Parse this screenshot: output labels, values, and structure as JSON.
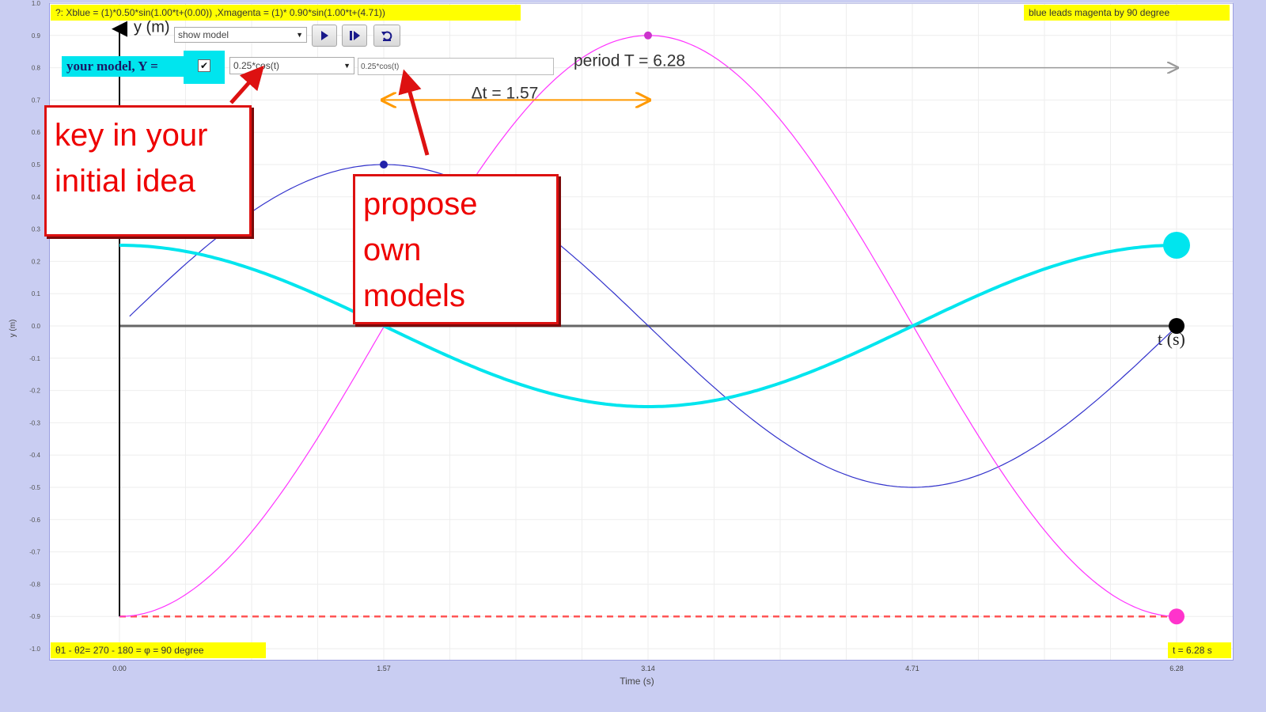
{
  "chart_data": {
    "type": "line",
    "xlabel": "Time (s)",
    "ylabel": "y (m)",
    "xlim": [
      0,
      6.28
    ],
    "ylim": [
      -1.0,
      1.0
    ],
    "x_ticks": [
      "0.00",
      "1.57",
      "3.14",
      "4.71",
      "6.28"
    ],
    "y_ticks": [
      "1.0",
      "0.9",
      "0.8",
      "0.7",
      "0.6",
      "0.5",
      "0.4",
      "0.3",
      "0.2",
      "0.1",
      "0.0",
      "-0.1",
      "-0.2",
      "-0.3",
      "-0.4",
      "-0.5",
      "-0.6",
      "-0.7",
      "-0.8",
      "-0.9",
      "-1.0"
    ],
    "grid": true,
    "series": [
      {
        "color": "#3333cc",
        "amplitude": 0.5,
        "omega": 1.0,
        "phase": 0.0,
        "func": "sin",
        "x_start": 0.06,
        "x_end": 6.28
      },
      {
        "color": "#ff33ff",
        "amplitude": 0.9,
        "omega": 1.0,
        "phase": 4.71,
        "func": "sin",
        "x_start": 0.0,
        "x_end": 6.28
      },
      {
        "color": "#00e5ee",
        "amplitude": 0.25,
        "omega": 1.0,
        "phase": 0.0,
        "func": "cos",
        "x_start": 0.0,
        "x_end": 6.28
      }
    ],
    "markers": [
      {
        "name": "blue-peak",
        "x": 1.57,
        "y": 0.5,
        "color": "#2222aa",
        "size": "small"
      },
      {
        "name": "magenta-peak",
        "x": 3.14,
        "y": 0.9,
        "color": "#cc33cc",
        "size": "small"
      },
      {
        "name": "cyan-end",
        "x": 6.28,
        "y": 0.25,
        "color": "#00e5ee",
        "size": "large"
      },
      {
        "name": "black-end",
        "x": 6.28,
        "y": 0.0,
        "color": "#000000",
        "size": "medium"
      },
      {
        "name": "magenta-end",
        "x": 6.28,
        "y": -0.9,
        "color": "#ff33cc",
        "size": "medium"
      }
    ],
    "dashed_line_y": -0.9,
    "period_arrow": {
      "x_from": 3.14,
      "x_to": 6.28,
      "y": 0.8,
      "label": "period T = 6.28"
    },
    "dt_arrow": {
      "x_from": 1.57,
      "x_to": 3.14,
      "y": 0.7,
      "label": "Δt = 1.57"
    },
    "axis_y_label": "y (m)",
    "axis_t_label": "t (s)"
  },
  "header": {
    "equation": "?: Xblue = (1)*0.50*sin(1.00*t+(0.00)) ,Xmagenta = (1)* 0.90*sin(1.00*t+(4.71))",
    "phase_note": "blue leads magenta by 90 degree"
  },
  "footer": {
    "phase_calc": "θ1 - θ2= 270 - 180 = φ = 90 degree",
    "time_readout": "t = 6.28 s"
  },
  "controls": {
    "model_select": "show model",
    "your_model_label": "your model, Y =",
    "model_checkbox_checked": true,
    "model_expression_select": "0.25*cos(t)",
    "model_input_value": "0.25*cos(t)"
  },
  "callouts": {
    "key_in": [
      "key in your",
      "initial idea"
    ],
    "propose": [
      "propose",
      "own",
      "models"
    ]
  },
  "colors": {
    "background": "#c9cdf2",
    "highlight": "#ffff00",
    "model_label_bg": "#00e5ee",
    "callout_red": "#dd1111"
  }
}
